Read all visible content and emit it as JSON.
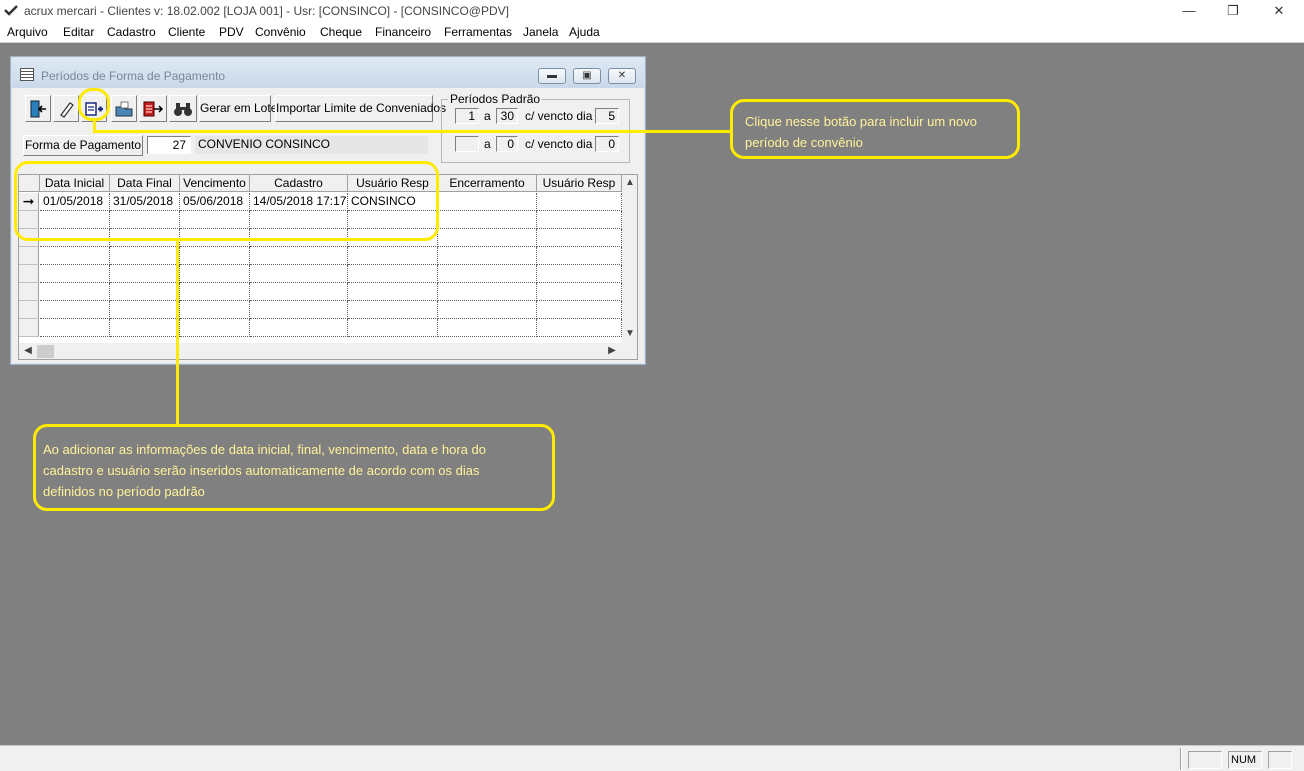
{
  "app": {
    "title": "acrux mercari - Clientes  v: 18.02.002  [LOJA 001] - Usr: [CONSINCO] - [CONSINCO@PDV]",
    "min_glyph": "—",
    "max_glyph": "❐",
    "close_glyph": "✕"
  },
  "menu": [
    "Arquivo",
    "Editar",
    "Cadastro",
    "Cliente",
    "PDV",
    "Convênio",
    "Cheque",
    "Financeiro",
    "Ferramentas",
    "Janela",
    "Ajuda"
  ],
  "window": {
    "title": "Períodos de Forma de Pagamento"
  },
  "toolbar": {
    "icons": [
      "exit-icon",
      "eraser-icon",
      "add-period-icon",
      "open-folder-icon",
      "export-icon",
      "binoculars-icon"
    ],
    "gerar_em_lote": "Gerar em Lote",
    "importar_limite": "Importar Limite de Conveniados"
  },
  "periodos_padrao": {
    "label": "Períodos Padrão",
    "row1": {
      "start": "1",
      "sep": "a",
      "end": "30",
      "vencto_label": "c/ vencto dia",
      "vencto": "5"
    },
    "row2": {
      "start": "",
      "sep": "a",
      "end": "0",
      "vencto_label": "c/ vencto dia",
      "vencto": "0"
    }
  },
  "forma_pagamento": {
    "button": "Forma de Pagamento",
    "code": "27",
    "name": "CONVENIO CONSINCO"
  },
  "grid": {
    "columns": [
      "Data Inicial",
      "Data Final",
      "Vencimento",
      "Cadastro",
      "Usuário Resp",
      "Encerramento",
      "Usuário Resp"
    ],
    "rows": [
      [
        "01/05/2018",
        "31/05/2018",
        "05/06/2018",
        "14/05/2018 17:17",
        "CONSINCO",
        "",
        ""
      ]
    ],
    "current_row_indicator": "➞"
  },
  "callouts": {
    "top": "Clique nesse botão para incluir um novo\nperíodo de convênio",
    "bottom": "Ao adicionar as informações de data inicial, final, vencimento, data e hora do\ncadastro e usuário serão inseridos automaticamente de acordo com os dias\ndefinidos no período padrão"
  },
  "status": {
    "num": "NUM"
  },
  "colors": {
    "callout": "#ffeb00",
    "desktop": "#808080"
  }
}
